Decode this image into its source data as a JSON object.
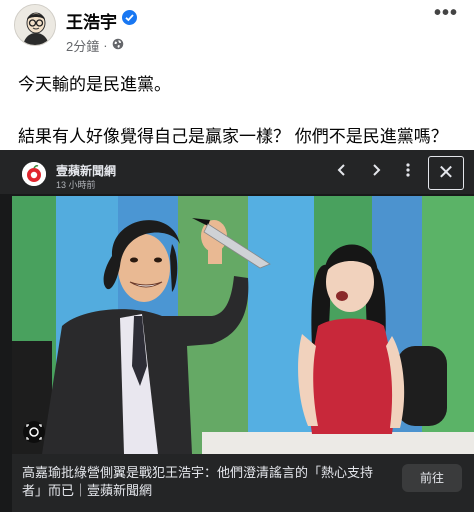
{
  "post": {
    "author": "王浩宇",
    "time": "2分鐘",
    "separator": "·",
    "privacy_icon": "globe-icon",
    "more_label": "•••",
    "line1": "今天輸的是民進黨。",
    "line2": "結果有人好像覺得自己是贏家一樣？ 你們不是民進黨嗎？"
  },
  "card": {
    "publisher": "壹蘋新聞網",
    "publisher_time": "13 小時前",
    "prev_label": "‹",
    "next_label": "›",
    "menu_label": "⋮",
    "close_label": "✕",
    "caption": "高嘉瑜批綠營側翼是戰犯王浩宇：他們澄清謠言的「熱心支持者」而已｜壹蘋新聞網",
    "cta_label": "前往"
  },
  "colors": {
    "verified": "#1877f2",
    "card_bg": "#18191a",
    "bar_bg": "#242526",
    "studio_blue": "#3a6fb0",
    "studio_green": "#3c9a52",
    "dress_red": "#c8283a"
  }
}
